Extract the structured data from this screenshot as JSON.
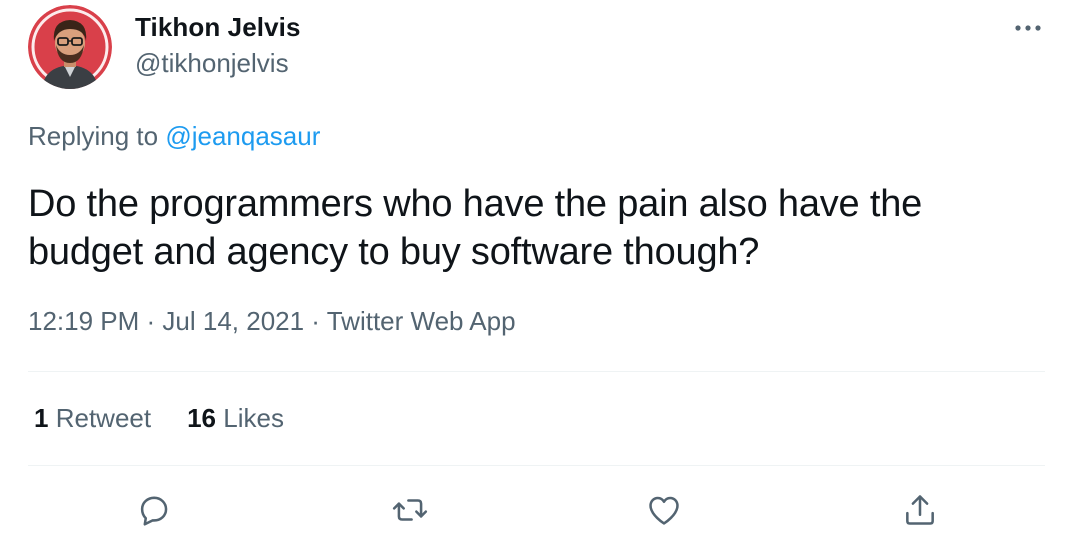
{
  "author": {
    "name": "Tikhon Jelvis",
    "handle": "@tikhonjelvis"
  },
  "reply": {
    "prefix": "Replying to",
    "mention": "@jeanqasaur"
  },
  "tweet": {
    "text": "Do the programmers who have the pain also have the budget and agency to buy software though?"
  },
  "meta": {
    "time": "12:19 PM",
    "separator1": " · ",
    "date": "Jul 14, 2021",
    "separator2": " · ",
    "source": "Twitter Web App"
  },
  "stats": {
    "retweets_count": "1",
    "retweets_label": "Retweet",
    "likes_count": "16",
    "likes_label": "Likes"
  },
  "actions": {
    "icons": [
      "reply-icon",
      "retweet-icon",
      "like-icon",
      "share-icon"
    ]
  },
  "colors": {
    "text_primary": "#0f1419",
    "text_secondary": "#536471",
    "link": "#1d9bf0",
    "divider": "#eff3f4",
    "avatar_bg": "#d9404a"
  }
}
